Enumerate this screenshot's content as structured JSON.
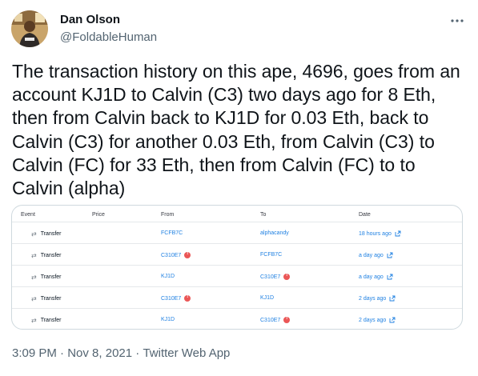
{
  "author": {
    "name": "Dan Olson",
    "handle": "@FoldableHuman"
  },
  "tweet": {
    "text": "The transaction history on this ape, 4696, goes from an account KJ1D to Calvin (C3) two days ago for 8 Eth, then from Calvin back to KJ1D for 0.03 Eth, back to Calvin (C3) for another 0.03 Eth, from Calvin (C3) to Calvin (FC) for 33 Eth, then from Calvin (FC) to to Calvin (alpha)"
  },
  "embed": {
    "headers": {
      "event": "Event",
      "price": "Price",
      "from": "From",
      "to": "To",
      "date": "Date"
    },
    "rows": [
      {
        "event": "Transfer",
        "from": "FCFB7C",
        "from_flag": false,
        "to": "alphacandy",
        "to_flag": false,
        "date": "18 hours ago"
      },
      {
        "event": "Transfer",
        "from": "C310E7",
        "from_flag": true,
        "to": "FCFB7C",
        "to_flag": false,
        "date": "a day ago"
      },
      {
        "event": "Transfer",
        "from": "KJ1D",
        "from_flag": false,
        "to": "C310E7",
        "to_flag": true,
        "date": "a day ago"
      },
      {
        "event": "Transfer",
        "from": "C310E7",
        "from_flag": true,
        "to": "KJ1D",
        "to_flag": false,
        "date": "2 days ago"
      },
      {
        "event": "Transfer",
        "from": "KJ1D",
        "from_flag": false,
        "to": "C310E7",
        "to_flag": true,
        "date": "2 days ago"
      }
    ]
  },
  "meta": {
    "time": "3:09 PM",
    "separator1": " · ",
    "date": "Nov 8, 2021",
    "separator2": " · ",
    "source": "Twitter Web App"
  },
  "colors": {
    "link": "#2081e2",
    "secondary_text": "#536471",
    "warning_badge": "#eb5757"
  },
  "icons": {
    "more": "more-horizontal-icon",
    "transfer": "transfer-arrows-icon",
    "external_link": "external-link-icon",
    "warning": "warning-badge-icon"
  }
}
